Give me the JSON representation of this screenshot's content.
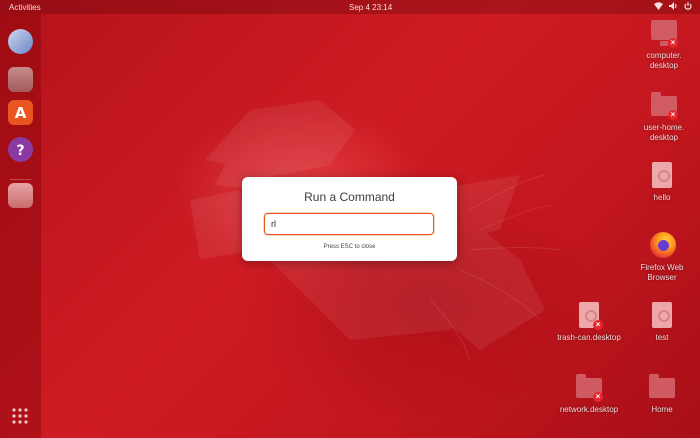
{
  "topbar": {
    "activities": "Activities",
    "clock": "Sep 4  23:14",
    "tray_icons": [
      "network-icon",
      "volume-icon",
      "power-icon"
    ]
  },
  "dock": {
    "items": [
      {
        "name": "thunderbird-icon"
      },
      {
        "name": "files-icon"
      },
      {
        "name": "software-icon"
      },
      {
        "name": "help-icon"
      },
      {
        "name": "trash-icon"
      }
    ],
    "apps_button": "show-applications-icon"
  },
  "desktop": {
    "icons": [
      {
        "label": "computer.\ndesktop",
        "type": "monitor",
        "broken": true
      },
      {
        "label": "user-home.\ndesktop",
        "type": "folder",
        "broken": true
      },
      {
        "label": "hello",
        "type": "document",
        "broken": false
      },
      {
        "label": "Firefox Web\nBrowser",
        "type": "firefox",
        "broken": false
      },
      {
        "label": "trash-can.desktop",
        "type": "document",
        "broken": true
      },
      {
        "label": "test",
        "type": "document",
        "broken": false
      },
      {
        "label": "network.desktop",
        "type": "folder",
        "broken": true
      },
      {
        "label": "Home",
        "type": "home-folder",
        "broken": false
      }
    ]
  },
  "run_dialog": {
    "title": "Run a Command",
    "input_value": "rl",
    "hint": "Press ESC to close"
  },
  "colors": {
    "wallpaper": "#c0151d",
    "accent": "#e95420",
    "dialog_bg": "#ffffff"
  }
}
